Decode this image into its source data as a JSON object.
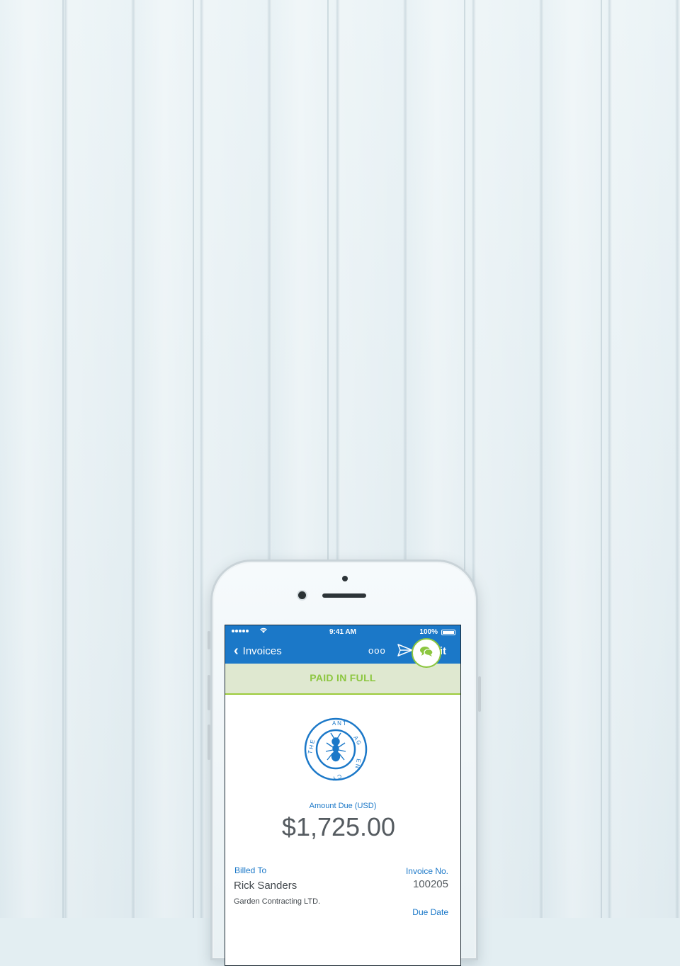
{
  "status_bar": {
    "time": "9:41 AM",
    "battery": "100%"
  },
  "nav": {
    "back_label": "Invoices",
    "more_label": "ooo",
    "edit_label": "Edit"
  },
  "banner": {
    "status": "PAID IN FULL"
  },
  "logo": {
    "text": "THE ANT AGENCY"
  },
  "invoice": {
    "amount_label": "Amount Due (USD)",
    "amount": "$1,725.00",
    "billed_to_label": "Billed To",
    "client_name": "Rick Sanders",
    "client_company": "Garden Contracting LTD.",
    "invoice_no_label": "Invoice No.",
    "invoice_no": "100205",
    "due_date_label": "Due Date"
  },
  "colors": {
    "brand_blue": "#1b78c8",
    "paid_green": "#8cc63f",
    "banner_bg": "#dfe8d0"
  },
  "icons": [
    "signal-icon",
    "wifi-icon",
    "battery-icon",
    "chevron-left-icon",
    "more-icon",
    "send-icon",
    "chat-icon",
    "ant-logo-icon"
  ]
}
